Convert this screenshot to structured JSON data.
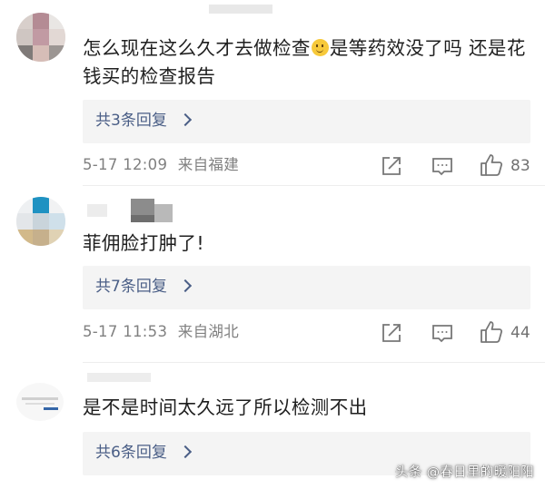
{
  "comments": [
    {
      "text_parts": [
        "怎么现在这么久才去做检查",
        "是等药效没了吗 还是花钱买的检查报告"
      ],
      "emoji": "slightly-smiling-emoji",
      "replies": "共3条回复",
      "timestamp": "5-17 12:09",
      "location": "来自福建",
      "likes": "83"
    },
    {
      "text": "菲佣脸打肿了!",
      "replies": "共7条回复",
      "timestamp": "5-17 11:53",
      "location": "来自湖北",
      "likes": "44"
    },
    {
      "text": "是不是时间太久远了所以检测不出",
      "replies": "共6条回复"
    }
  ],
  "watermark": "头条 @春日里的暖阳阳",
  "icons": {
    "share": "share-icon",
    "comment": "comment-icon",
    "like": "thumbs-up-icon",
    "chevron": "chevron-right-icon"
  },
  "colors": {
    "link": "#4a5e86",
    "meta": "#808080",
    "reply_bg": "#f4f4f4"
  }
}
